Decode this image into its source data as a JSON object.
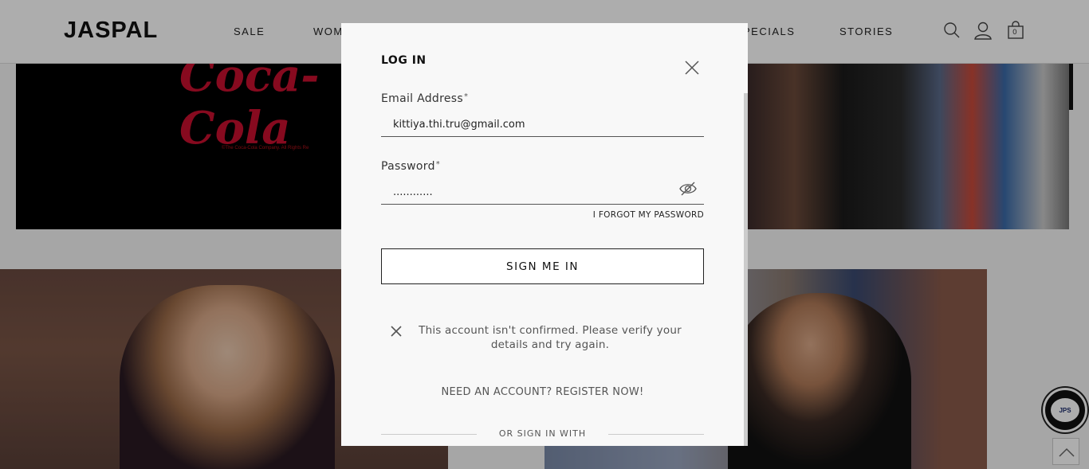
{
  "header": {
    "logo": "JASPAL",
    "nav": [
      "SALE",
      "WOM",
      "PECIALS",
      "STORIES"
    ],
    "cart_count": "0"
  },
  "banner": {
    "brand_script": "Coca-Cola",
    "copyright": "©The Coca-Cola Company. All Rights Re"
  },
  "login_modal": {
    "title": "LOG IN",
    "email": {
      "label": "Email Address",
      "required_mark": "*",
      "value": "kittiya.thi.tru@gmail.com"
    },
    "password": {
      "label": "Password",
      "required_mark": "*",
      "value": "............"
    },
    "forgot_label": "I FORGOT MY PASSWORD",
    "submit_label": "SIGN ME IN",
    "error_message": "This account isn't confirmed. Please verify your details and try again.",
    "register_label": "NEED AN ACCOUNT? REGISTER NOW!",
    "divider_label": "OR SIGN IN WITH"
  },
  "chat": {
    "badge": "JPS"
  },
  "icons": [
    "search-icon",
    "user-icon",
    "cart-icon",
    "close-icon",
    "eye-slash-icon",
    "error-x-icon",
    "chevron-up-icon"
  ]
}
